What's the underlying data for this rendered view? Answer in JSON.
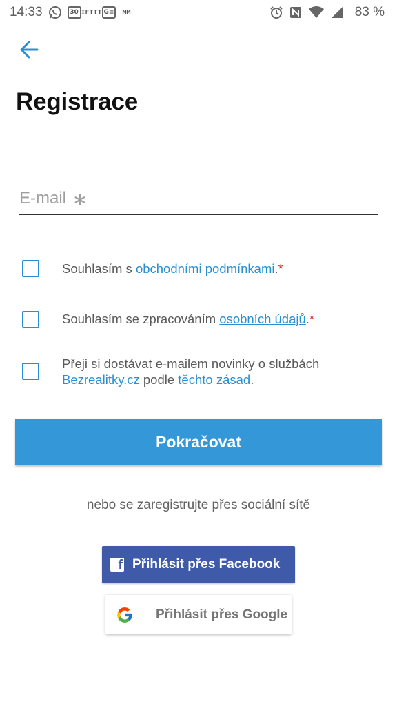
{
  "status_bar": {
    "time": "14:33",
    "notification_icons": [
      "whatsapp-icon",
      "calendar-icon",
      "ifttt-icon",
      "gmail-icon",
      "mm-app-icon"
    ],
    "calendar_day": "30",
    "ifttt_text": "IFTTT",
    "gmail_text": "G≡",
    "mm_text": "MM",
    "system_icons": [
      "alarm-icon",
      "nfc-icon",
      "wifi-icon",
      "signal-icon"
    ],
    "battery": "83 %"
  },
  "page": {
    "title": "Registrace",
    "back_icon": "arrow-left-icon"
  },
  "email": {
    "placeholder": "E-mail",
    "required_mark": "∗"
  },
  "consents": [
    {
      "prefix": "Souhlasím s ",
      "link": "obchodními podmínkami",
      "suffix": ".",
      "required": "*"
    },
    {
      "prefix": "Souhlasím se zpracováním ",
      "link": "osobních údajů",
      "suffix": ".",
      "required": "*"
    },
    {
      "line1": "Přeji si dostávat e-mailem novinky o službách",
      "link1": "Bezrealitky.cz",
      "middle": " podle ",
      "link2": "těchto zásad",
      "suffix": "."
    }
  ],
  "continue_button": "Pokračovat",
  "social": {
    "caption": "nebo se zaregistrujte přes sociální sítě",
    "facebook_label": "Přihlásit přes Facebook",
    "google_label": "Přihlásit přes Google"
  },
  "colors": {
    "accent": "#3497d8",
    "link": "#2a8fd1",
    "required": "#d32f2f",
    "facebook": "#3f5aa8"
  }
}
